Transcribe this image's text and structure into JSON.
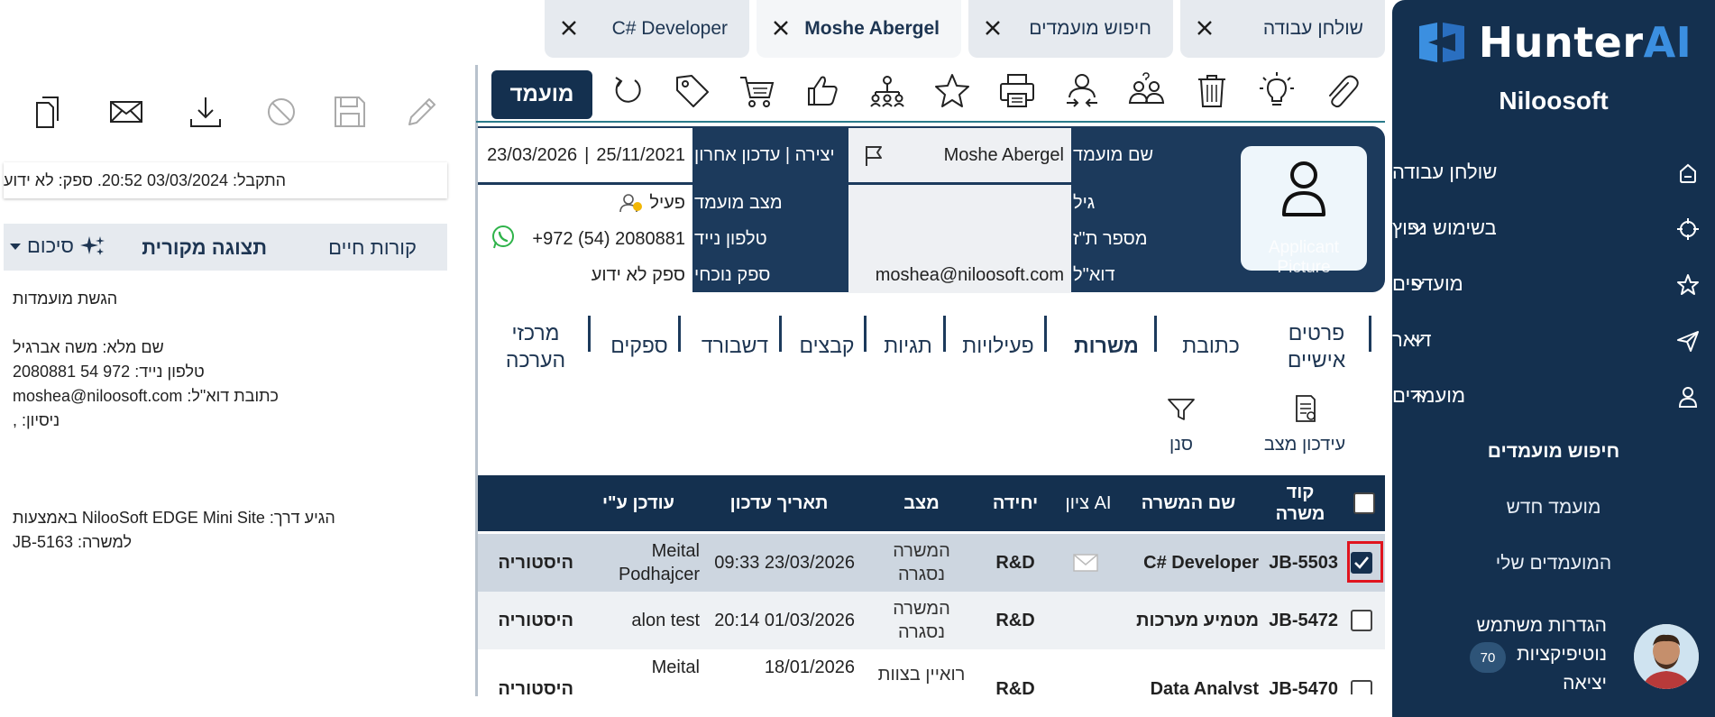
{
  "sidebar": {
    "logo_main": "Hunter",
    "logo_ai": "AI",
    "company": "Niloosoft",
    "items": [
      {
        "label": "שולחן עבודה"
      },
      {
        "label": "בשימוש נפוץ"
      },
      {
        "label": "מועדפים"
      },
      {
        "label": "דואר"
      },
      {
        "label": "מועמדים"
      }
    ],
    "subitems": [
      {
        "label": "חיפוש מועמדים"
      },
      {
        "label": "מועמד חדש"
      },
      {
        "label": "המועמדים שלי"
      }
    ],
    "profile": {
      "settings": "הגדרות משתמש",
      "notifications": "נוטיפיקציות",
      "notifications_count": "70",
      "logout": "יציאה"
    }
  },
  "tabs": [
    {
      "label": "שולחן עבודה"
    },
    {
      "label": "חיפוש מועמדים"
    },
    {
      "label": "Moshe Abergel"
    },
    {
      "label": "C# Developer"
    }
  ],
  "toolbar": {
    "status_button": "מועמד"
  },
  "candidate": {
    "picture_label": "Applicant Picture",
    "name_label": "שם מועמד",
    "name": "Moshe Abergel",
    "age_label": "גיל",
    "age": "",
    "id_label": "מספר ת\"ז",
    "id": "",
    "email_label": "דוא\"ל",
    "email": "moshea@niloosoft.com",
    "created_label": "יצירה | עדכון אחרון",
    "created": "25/11/2021",
    "updated": "23/03/2026",
    "status_label": "מצב מועמד",
    "status": "פעיל",
    "phone_label": "טלפון נייד",
    "phone": "+972 (54) 2080881",
    "supplier_label": "ספק נוכחי",
    "supplier": "ספק לא ידוע"
  },
  "sections": {
    "personal": "פרטים אישיים",
    "address": "כתובת",
    "jobs": "משרות",
    "activities": "פעילויות",
    "tags": "תגיות",
    "files": "קבצים",
    "dashboard": "דשבורד",
    "suppliers": "ספקים",
    "assessment": "מרכזי הערכה"
  },
  "actions": {
    "status_update": "עידכון מצב",
    "filter": "סנן"
  },
  "table": {
    "headers": {
      "code": "קוד משרה",
      "name": "שם המשרה",
      "ai": "ציון AI",
      "unit": "יחידה",
      "status": "מצב",
      "date": "תאריך עדכון",
      "by": "עודכן ע\"י"
    },
    "rows": [
      {
        "code": "JB-5503",
        "name": "C# Developer",
        "unit": "R&D",
        "status": "המשרה נסגרה",
        "date": "23/03/2026 09:33",
        "by": "Meital Podhajcer",
        "history": "היסטוריה",
        "checked": true
      },
      {
        "code": "JB-5472",
        "name": "מטמיע מערכות",
        "unit": "R&D",
        "status": "המשרה נסגרה",
        "date": "01/03/2026 20:14",
        "by": "alon test",
        "history": "היסטוריה",
        "checked": false
      },
      {
        "code": "JB-5470",
        "name": "Data Analyst",
        "unit": "R&D",
        "status": "רואיין בצוות",
        "date": "18/01/2026",
        "by": "Meital",
        "history": "היסטוריה",
        "checked": false
      }
    ]
  },
  "preview": {
    "received": "התקבל: 03/03/2024 20:52. ספק: לא ידוע",
    "tab_cv": "קורות חיים",
    "tab_original": "תצוגה מקורית",
    "tab_summary": "סיכום",
    "cv_lines": [
      "הגשת מועמדות",
      "",
      "שם מלא: משה אברגיל",
      "טלפון נייד: 972 54 2080881",
      "כתובת דוא\"ל: moshea@niloosoft.com",
      "ניסיון: ,",
      "",
      "",
      "",
      "הגיע דרך: NilooSoft EDGE Mini Site באמצעות",
      "למשרה: JB-5163"
    ]
  }
}
